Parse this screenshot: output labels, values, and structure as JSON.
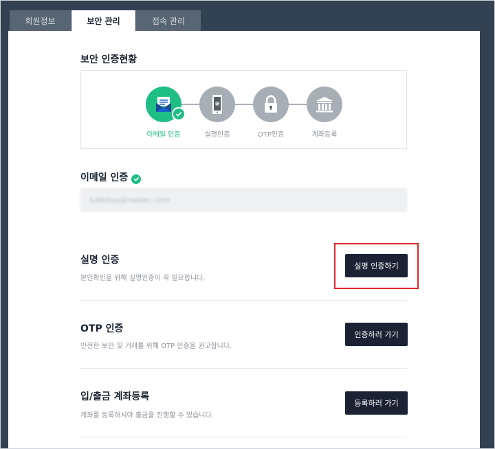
{
  "tabs": [
    {
      "label": "회원정보",
      "active": false
    },
    {
      "label": "보안 관리",
      "active": true
    },
    {
      "label": "접속 관리",
      "active": false
    }
  ],
  "status": {
    "title": "보안 인증현황",
    "steps": [
      {
        "label": "이메일 인증",
        "done": true,
        "icon": "mail-icon"
      },
      {
        "label": "실명인증",
        "done": false,
        "icon": "phone-icon"
      },
      {
        "label": "OTP인증",
        "done": false,
        "icon": "lock-icon"
      },
      {
        "label": "계좌등록",
        "done": false,
        "icon": "bank-icon"
      }
    ]
  },
  "email": {
    "title": "이메일 인증",
    "value": "kdtkbas@naelec.com"
  },
  "rows": [
    {
      "title": "실명 인증",
      "desc": "본인확인을 위해 실명인증이 꼭 필요합니다.",
      "button": "실명 인증하기"
    },
    {
      "title": "OTP 인증",
      "desc": "안전한 보안 및 거래를 위해 OTP 인증을 권고합니다.",
      "button": "인증하러 가기"
    },
    {
      "title": "입/출금 계좌등록",
      "desc": "계좌를 등록하셔야 출금을 진행할 수 있습니다.",
      "button": "등록하러 가기"
    }
  ],
  "colors": {
    "accent": "#1fbe85",
    "dark": "#1b2233",
    "header": "#334252",
    "highlight": "#e1262d"
  }
}
